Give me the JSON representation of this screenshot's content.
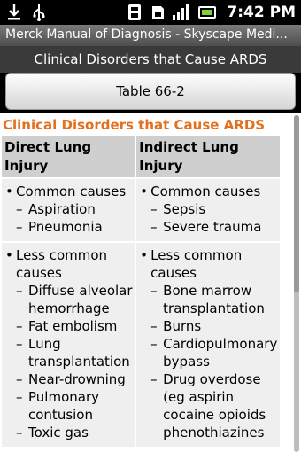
{
  "statusbar": {
    "left_icons": [
      "download-icon",
      "usb-icon"
    ],
    "right_icons": [
      "data-icon",
      "storage-icon",
      "signal-icon",
      "battery-icon"
    ],
    "time": "7:42 PM"
  },
  "app": {
    "title": "Merck Manual of Diagnosis - Skyscape Medi..."
  },
  "header": {
    "title": "Clinical Disorders that Cause ARDS"
  },
  "table_button": {
    "label": "Table 66-2"
  },
  "content": {
    "title": "Clinical Disorders that Cause ARDS",
    "columns": [
      "Direct Lung Injury",
      "Indirect Lung Injury"
    ],
    "rows": [
      {
        "col1": {
          "bullet": "Common causes",
          "items": [
            "Aspiration",
            "Pneumonia"
          ]
        },
        "col2": {
          "bullet": "Common causes",
          "items": [
            "Sepsis",
            "Severe trauma"
          ]
        }
      },
      {
        "col1": {
          "bullet": "Less common causes",
          "items": [
            "Diffuse alveolar hemorrhage",
            "Fat embolism",
            "Lung transplantation",
            "Near-drowning",
            "Pulmonary contusion",
            "Toxic gas"
          ]
        },
        "col2": {
          "bullet": "Less common causes",
          "items": [
            "Bone marrow transplantation",
            "Burns",
            "Cardiopulmonary bypass",
            "Drug overdose (eg aspirin cocaine opioids phenothiazines"
          ]
        }
      }
    ]
  },
  "colors": {
    "accent_title": "#e3701e",
    "header_bg": "#3a3a3a",
    "table_header_bg": "#cfcfcf",
    "table_cell_bg": "#efefef"
  }
}
